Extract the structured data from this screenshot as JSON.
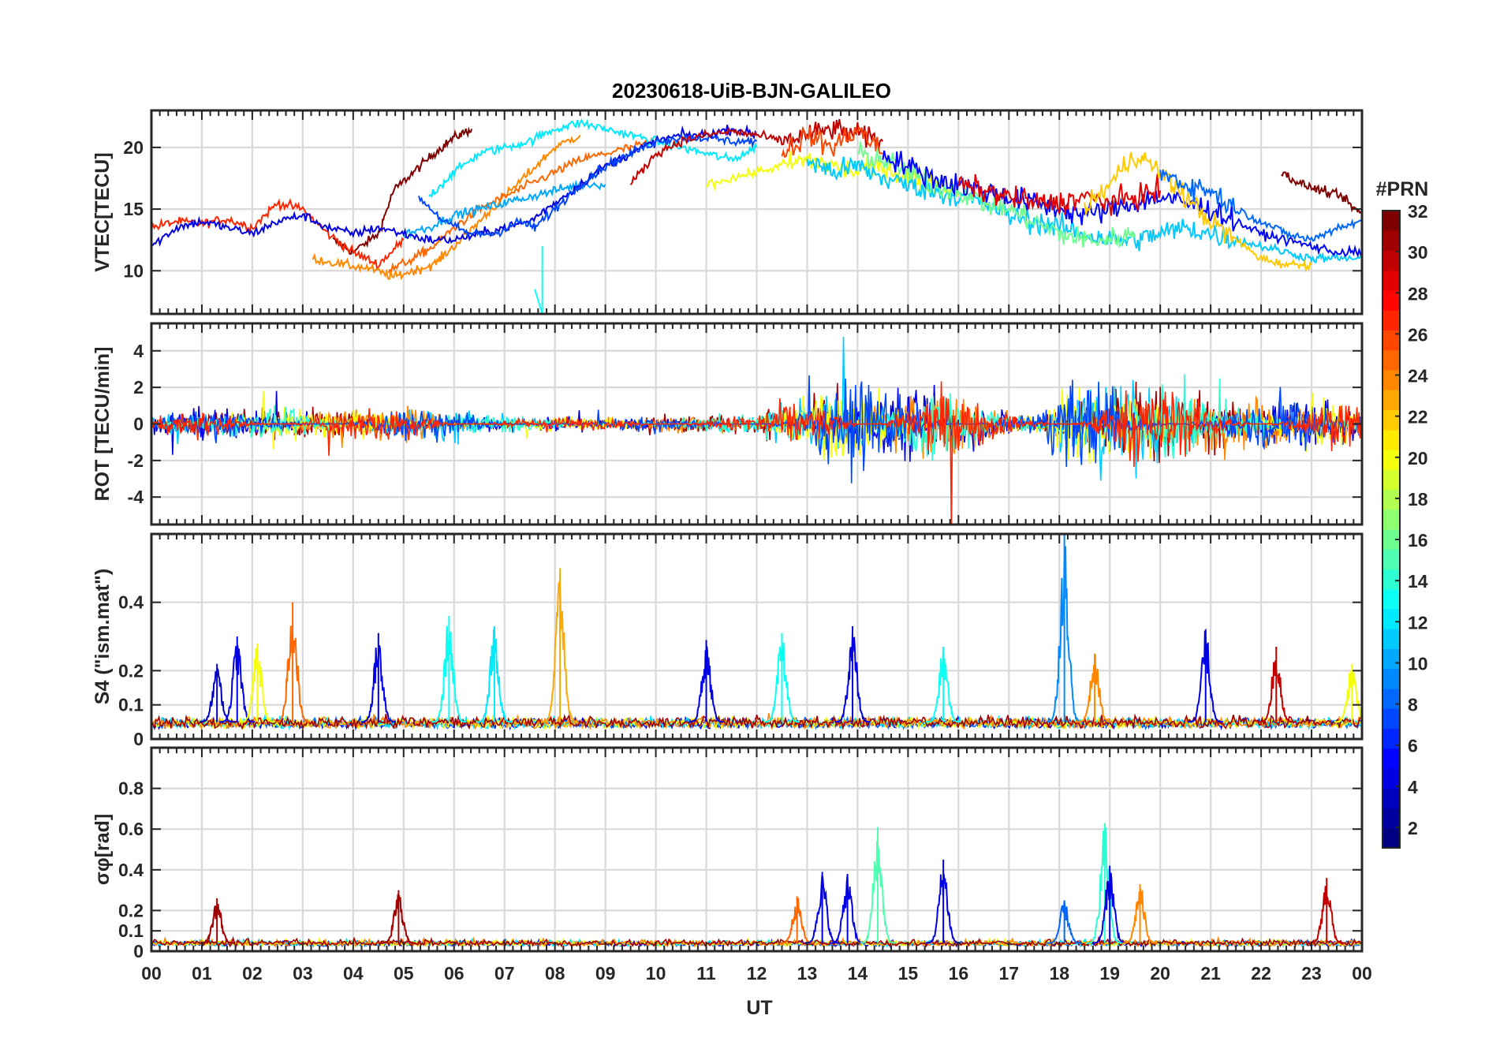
{
  "chart_data": {
    "type": "line",
    "title": "20230618-UiB-BJN-GALILEO",
    "xlabel": "UT",
    "x_ticks": [
      "00",
      "01",
      "02",
      "03",
      "04",
      "05",
      "06",
      "07",
      "08",
      "09",
      "10",
      "11",
      "12",
      "13",
      "14",
      "15",
      "16",
      "17",
      "18",
      "19",
      "20",
      "21",
      "22",
      "23",
      "00"
    ],
    "x_range_hours": [
      0,
      24
    ],
    "grid": true,
    "colorbar": {
      "label": "#PRN",
      "ticks": [
        "32",
        "30",
        "28",
        "26",
        "24",
        "22",
        "20",
        "18",
        "16",
        "14",
        "12",
        "10",
        "8",
        "6",
        "4",
        "2"
      ],
      "range": [
        1,
        32
      ],
      "colormap": "jet",
      "colors": [
        "#00007f",
        "#0000ff",
        "#007fff",
        "#00ffff",
        "#7fff7f",
        "#ffff00",
        "#ff7f00",
        "#ff0000",
        "#7f0000"
      ]
    },
    "panels": [
      {
        "ylabel": "VTEC[TECU]",
        "ylim": [
          6.5,
          23
        ],
        "yticks": [
          10,
          15,
          20
        ],
        "ytick_labels": [
          "10",
          "15",
          "20"
        ],
        "series": [
          {
            "prn": 32,
            "x": [
              3.6,
              4.0,
              4.5,
              4.8,
              5.2,
              5.6,
              6.0,
              6.35
            ],
            "y": [
              12.5,
              11.5,
              13,
              16.5,
              18,
              19.5,
              20.8,
              21.5
            ]
          },
          {
            "prn": 27,
            "x": [
              0.0,
              0.5,
              1.0,
              1.5,
              2.0,
              2.5,
              3.0,
              3.5,
              4.0,
              4.5,
              5.0
            ],
            "y": [
              13.5,
              14,
              13.8,
              14.2,
              13.5,
              15.5,
              15,
              13,
              11.5,
              10.5,
              12.5
            ]
          },
          {
            "prn": 24,
            "x": [
              3.2,
              3.8,
              4.3,
              4.8,
              5.2,
              5.6,
              6.0,
              6.5,
              7.0,
              7.5,
              8.0,
              8.5
            ],
            "y": [
              11,
              10.5,
              10.2,
              9.5,
              10,
              10.5,
              12,
              14,
              16,
              18,
              20,
              21
            ]
          },
          {
            "prn": 25,
            "x": [
              4.7,
              5.2,
              5.6,
              6.0,
              6.5,
              7.0,
              7.5,
              8.0,
              8.5,
              9.0,
              9.5,
              10.0
            ],
            "y": [
              10,
              11,
              12,
              13.5,
              15,
              16,
              17,
              18,
              19,
              19.5,
              20,
              20.5
            ]
          },
          {
            "prn": 12,
            "x": [
              5.5,
              6.0,
              6.5,
              7.0,
              7.5,
              8.0,
              8.5,
              9.0,
              9.5,
              10.0,
              10.5,
              11.0,
              11.5,
              12.0
            ],
            "y": [
              16,
              18,
              19.5,
              20,
              20.5,
              21.5,
              22,
              21.5,
              21,
              20.5,
              20,
              19.5,
              19,
              20
            ]
          },
          {
            "prn": 10,
            "x": [
              5.0,
              5.5,
              6.0,
              6.5,
              7.0,
              7.5,
              8.0,
              8.5,
              9.0
            ],
            "y": [
              13,
              13.5,
              14.5,
              15,
              15.5,
              16,
              16.5,
              17,
              17
            ]
          },
          {
            "prn": 4,
            "x": [
              0.0,
              0.5,
              1.0,
              1.5,
              2.0,
              2.5,
              3.0,
              3.5,
              4.0,
              4.5,
              5.0,
              5.5,
              6.0,
              6.5,
              7.0,
              7.5,
              8.0,
              8.5,
              9.0,
              9.5,
              10.0,
              10.5,
              11.0,
              11.5,
              12.0
            ],
            "y": [
              12,
              13.5,
              14,
              13.5,
              13,
              14,
              14.5,
              13.5,
              13,
              13.5,
              13,
              12.5,
              12.5,
              13,
              13.5,
              14,
              15.5,
              17,
              18.5,
              19.5,
              20.5,
              21,
              21,
              21.5,
              21
            ]
          },
          {
            "prn": 7,
            "x": [
              5.3,
              5.8,
              6.3,
              6.8,
              7.3,
              7.6,
              8.0,
              8.5,
              9.0,
              9.5,
              10.0,
              10.5,
              11.0,
              11.5,
              12.0
            ],
            "y": [
              16,
              14,
              13,
              13,
              14,
              13.5,
              15,
              17,
              18.5,
              19.5,
              20.5,
              20.8,
              20.8,
              20.5,
              20.5
            ]
          },
          {
            "prn": 30,
            "x": [
              9.5,
              10.0,
              10.5,
              11.0,
              11.5,
              12.0,
              12.5,
              13.0,
              13.5,
              14.0,
              14.5
            ],
            "y": [
              17,
              19.5,
              20.5,
              21,
              21.3,
              21,
              20.5,
              21,
              21.5,
              21,
              20.5
            ]
          },
          {
            "prn": 20,
            "x": [
              11.0,
              11.5,
              12.0,
              12.5,
              13.0,
              13.5,
              14.0,
              14.5,
              15.0,
              15.5,
              16.0
            ],
            "y": [
              17,
              17.5,
              18,
              18.5,
              19,
              18.5,
              18,
              18.5,
              17.5,
              17,
              16.5
            ]
          },
          {
            "prn": 26,
            "x": [
              12.5,
              13.0,
              13.5,
              14.0,
              14.5
            ],
            "y": [
              19.5,
              21,
              20,
              21.5,
              19.5
            ]
          },
          {
            "prn": 11,
            "x": [
              13.0,
              13.5,
              14.0,
              14.5,
              15.0,
              15.5,
              16.0,
              16.5,
              17.0,
              17.5,
              18.0,
              18.5,
              19.0,
              19.5,
              20.0,
              20.5,
              21.0,
              21.5,
              22.0,
              22.5,
              23.0,
              23.5,
              24.0
            ],
            "y": [
              19,
              18,
              18.5,
              17.5,
              17,
              16.5,
              16,
              15.5,
              14.5,
              14,
              13.5,
              13,
              12.5,
              12.5,
              13,
              13.5,
              13,
              12.5,
              12,
              11.5,
              11,
              11,
              11
            ]
          },
          {
            "prn": 16,
            "x": [
              14.0,
              14.5,
              15.0,
              15.5,
              16.0,
              16.5,
              17.0,
              17.5,
              18.0,
              18.5,
              19.0,
              19.5
            ],
            "y": [
              19.5,
              19,
              18,
              17,
              16.5,
              15.5,
              15,
              14,
              13,
              12.5,
              12.5,
              13
            ]
          },
          {
            "prn": 5,
            "x": [
              14.5,
              15.0,
              15.5,
              16.0,
              16.5,
              17.0,
              17.5,
              18.0,
              18.5,
              19.0,
              19.5,
              20.0,
              20.5,
              21.0,
              21.5,
              22.0,
              22.5,
              23.0,
              23.5,
              24.0
            ],
            "y": [
              19.5,
              18.5,
              17.5,
              17,
              16.5,
              16,
              15.5,
              15,
              14.5,
              15,
              15.5,
              16,
              15.5,
              15,
              14,
              13,
              12.5,
              12,
              11.5,
              11.5
            ]
          },
          {
            "prn": 29,
            "x": [
              16.0,
              16.5,
              17.0,
              17.5,
              18.0,
              18.5,
              19.0,
              19.5,
              20.0
            ],
            "y": [
              17,
              16.5,
              16,
              15.5,
              15.5,
              16,
              15.5,
              16,
              16.5
            ]
          },
          {
            "prn": 22,
            "x": [
              18.5,
              19.0,
              19.5,
              20.0,
              20.5,
              21.0,
              21.5,
              22.0,
              22.5,
              23.0
            ],
            "y": [
              15,
              17,
              19.5,
              18,
              16,
              14,
              12.5,
              11,
              10.5,
              10.5
            ]
          },
          {
            "prn": 32,
            "x": [
              22.4,
              22.8,
              23.2,
              23.6,
              24.0
            ],
            "y": [
              18,
              17,
              16.5,
              16,
              14.5
            ]
          },
          {
            "prn": 8,
            "x": [
              20.0,
              20.5,
              21.0,
              21.5,
              22.0,
              22.5,
              23.0,
              23.5,
              24.0
            ],
            "y": [
              18,
              17,
              16.5,
              15,
              14,
              13,
              12.5,
              13.5,
              14
            ]
          }
        ]
      },
      {
        "ylabel": "ROT [TECU/min]",
        "ylim": [
          -5.5,
          5.5
        ],
        "yticks": [
          -4,
          -2,
          0,
          2,
          4
        ],
        "ytick_labels": [
          "-4",
          "-2",
          "0",
          "2",
          "4"
        ],
        "noise_envelope_hours": [
          0,
          1,
          2,
          3,
          4,
          5,
          6,
          7,
          8,
          9,
          10,
          11,
          12,
          12.8,
          13.5,
          14.5,
          15.5,
          16.5,
          17.5,
          18.5,
          19.5,
          20.5,
          21.5,
          22.5,
          23.5,
          24
        ],
        "noise_envelope_amp": [
          0.5,
          0.8,
          0.7,
          0.8,
          0.9,
          1.0,
          0.7,
          0.5,
          0.4,
          0.3,
          0.4,
          0.5,
          0.6,
          1.5,
          2.0,
          2.2,
          2.0,
          1.0,
          0.8,
          2.5,
          2.2,
          1.8,
          1.2,
          1.5,
          1.3,
          1.0
        ]
      },
      {
        "ylabel": "S4 (\"ism.mat\")",
        "ylim": [
          0,
          0.6
        ],
        "yticks": [
          0,
          0.1,
          0.2,
          0.4
        ],
        "ytick_labels": [
          "0",
          "0.1",
          "0.2",
          "0.4"
        ],
        "peaks": [
          {
            "prn": 3,
            "t": 1.3,
            "v": 0.22
          },
          {
            "prn": 4,
            "t": 1.7,
            "v": 0.3
          },
          {
            "prn": 20,
            "t": 2.1,
            "v": 0.28
          },
          {
            "prn": 25,
            "t": 2.8,
            "v": 0.4
          },
          {
            "prn": 4,
            "t": 4.5,
            "v": 0.31
          },
          {
            "prn": 13,
            "t": 5.9,
            "v": 0.36
          },
          {
            "prn": 12,
            "t": 6.8,
            "v": 0.33
          },
          {
            "prn": 23,
            "t": 8.1,
            "v": 0.5
          },
          {
            "prn": 4,
            "t": 11.0,
            "v": 0.29
          },
          {
            "prn": 13,
            "t": 12.5,
            "v": 0.31
          },
          {
            "prn": 4,
            "t": 13.9,
            "v": 0.33
          },
          {
            "prn": 13,
            "t": 15.7,
            "v": 0.27
          },
          {
            "prn": 9,
            "t": 18.1,
            "v": 0.6
          },
          {
            "prn": 24,
            "t": 18.7,
            "v": 0.25
          },
          {
            "prn": 4,
            "t": 20.9,
            "v": 0.32
          },
          {
            "prn": 30,
            "t": 22.3,
            "v": 0.27
          },
          {
            "prn": 20,
            "t": 23.8,
            "v": 0.22
          }
        ]
      },
      {
        "ylabel": "σφ[rad]",
        "ylim": [
          0,
          1.0
        ],
        "yticks": [
          0,
          0.1,
          0.2,
          0.4,
          0.6,
          0.8
        ],
        "ytick_labels": [
          "0",
          "0.1",
          "0.2",
          "0.4",
          "0.6",
          "0.8"
        ],
        "peaks": [
          {
            "prn": 31,
            "t": 1.3,
            "v": 0.26
          },
          {
            "prn": 31,
            "t": 4.9,
            "v": 0.3
          },
          {
            "prn": 25,
            "t": 12.8,
            "v": 0.27
          },
          {
            "prn": 4,
            "t": 13.3,
            "v": 0.39
          },
          {
            "prn": 4,
            "t": 13.8,
            "v": 0.38
          },
          {
            "prn": 15,
            "t": 14.4,
            "v": 0.61
          },
          {
            "prn": 4,
            "t": 15.7,
            "v": 0.45
          },
          {
            "prn": 8,
            "t": 18.1,
            "v": 0.25
          },
          {
            "prn": 14,
            "t": 18.9,
            "v": 0.63
          },
          {
            "prn": 4,
            "t": 19.0,
            "v": 0.42
          },
          {
            "prn": 24,
            "t": 19.6,
            "v": 0.33
          },
          {
            "prn": 30,
            "t": 23.3,
            "v": 0.36
          }
        ]
      }
    ]
  }
}
